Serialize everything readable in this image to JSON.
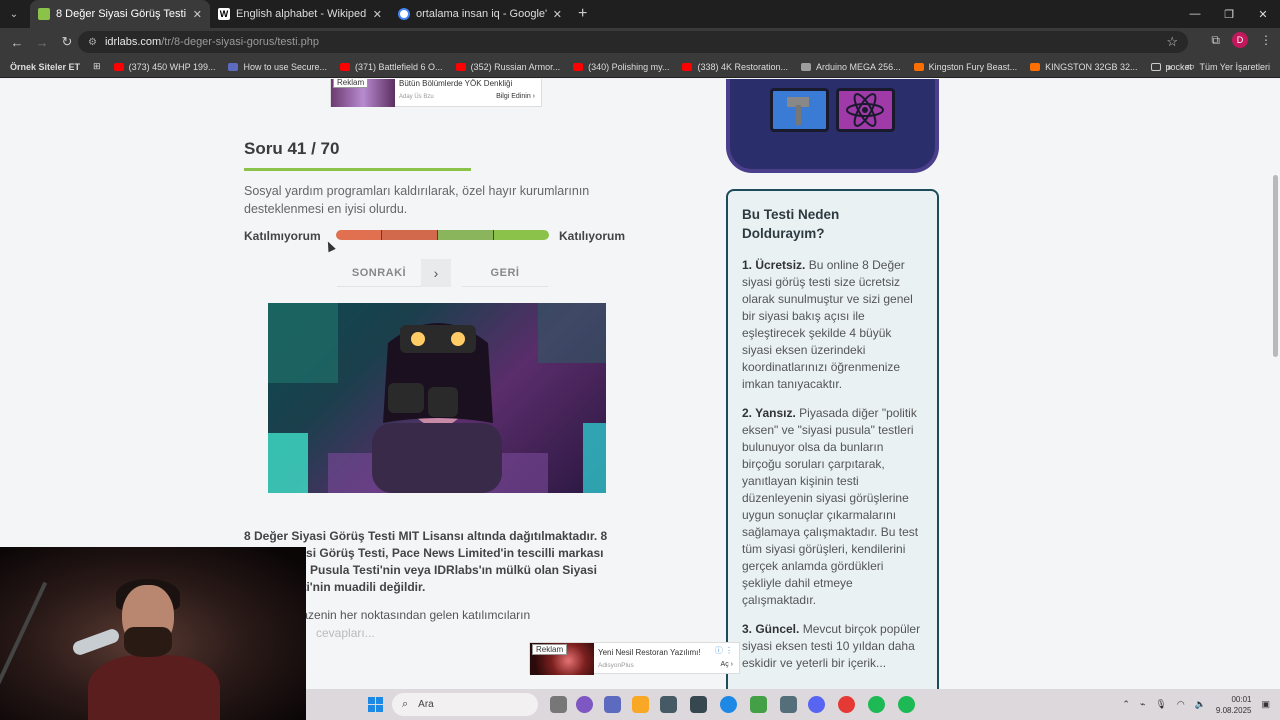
{
  "browser": {
    "tabs": [
      {
        "title": "8 Değer Siyasi Görüş Testi",
        "active": true,
        "favicon_color": "#8bc34a"
      },
      {
        "title": "English alphabet - Wikipedia",
        "active": false,
        "favicon_color": "#ffffff"
      },
      {
        "title": "ortalama insan iq - Google'da A",
        "active": false,
        "favicon_color": "#4285f4"
      }
    ],
    "url_domain": "idrlabs.com",
    "url_path": "/tr/8-deger-siyasi-gorus/testi.php",
    "bookmarks": [
      {
        "label": "Örnek Siteler ET",
        "bold": true,
        "color": ""
      },
      {
        "label": "(373) 450 WHP 199...",
        "color": "#ff0000"
      },
      {
        "label": "How to use Secure...",
        "color": "#5c6bc0"
      },
      {
        "label": "(371) Battlefield 6 O...",
        "color": "#ff0000"
      },
      {
        "label": "(352) Russian Armor...",
        "color": "#ff0000"
      },
      {
        "label": "(340) Polishing my...",
        "color": "#ff0000"
      },
      {
        "label": "(338) 4K Restoration...",
        "color": "#ff0000"
      },
      {
        "label": "Arduino MEGA 256...",
        "color": "#9e9e9e"
      },
      {
        "label": "Kingston Fury Beast...",
        "color": "#ff6f00"
      },
      {
        "label": "KINGSTON 32GB 32...",
        "color": "#ff6f00"
      },
      {
        "label": "pocket",
        "color": ""
      }
    ],
    "all_bookmarks": "Tüm Yer İşaretleri",
    "profile_initial": "D"
  },
  "ad_top": {
    "badge": "Reklam",
    "title": "Bütün Bölümlerde YÖK Denkliği",
    "source": "Aday Üs Bzu",
    "cta": "Bilgi Edinin"
  },
  "question": {
    "title": "Soru 41 / 70",
    "text": "Sosyal yardım programları kaldırılarak, özel hayır kurumlarının desteklenmesi en iyisi olurdu.",
    "left_label": "Katılmıyorum",
    "right_label": "Katılıyorum",
    "next_label": "SONRAKİ",
    "back_label": "GERİ"
  },
  "scale_colors": [
    "#e07050",
    "#d2694c",
    "#8ab55c",
    "#8bc34a"
  ],
  "license": {
    "bold_text": "8 Değer Siyasi Görüş Testi MIT Lisansı altında dağıtılmaktadır. 8 Değer Siyasi Görüş Testi, Pace News Limited'in tescilli markası olan Siyasi Pusula Testi'nin veya IDRlabs'ın mülkü olan Siyasi Eksen Testi'nin muadili değildir.",
    "text_line1": "Siyasi yelpazenin her noktasından gelen katılımcıların",
    "text_line2": "cevapları..."
  },
  "why": {
    "heading": "Bu Testi Neden Doldurayım?",
    "items": [
      {
        "title": "1. Ücretsiz.",
        "body": "Bu online 8 Değer siyasi görüş testi size ücretsiz olarak sunulmuştur ve sizi genel bir siyasi bakış açısı ile eşleştirecek şekilde 4 büyük siyasi eksen üzerindeki koordinatlarınızı öğrenmenize imkan tanıyacaktır."
      },
      {
        "title": "2. Yansız.",
        "body": "Piyasada diğer \"politik eksen\" ve \"siyasi pusula\" testleri bulunuyor olsa da bunların birçoğu soruları çarpıtarak, yanıtlayan kişinin testi düzenleyenin siyasi görüşlerine uygun sonuçlar çıkarmalarını sağlamaya çalışmaktadır. Bu test tüm siyasi görüşleri, kendilerini gerçek anlamda gördükleri şekliyle dahil etmeye çalışmaktadır."
      },
      {
        "title": "3. Güncel.",
        "body": "Mevcut birçok popüler siyasi eksen testi 10 yıldan daha eskidir ve yeterli bir içerik..."
      }
    ]
  },
  "ad_bottom": {
    "badge": "Reklam",
    "title": "Yeni Nesil Restoran Yazılımı!",
    "source": "AdisyonPlus",
    "cta": "Aç"
  },
  "taskbar": {
    "search": "Ara",
    "time": "00:01",
    "date": "9.08.2025"
  }
}
